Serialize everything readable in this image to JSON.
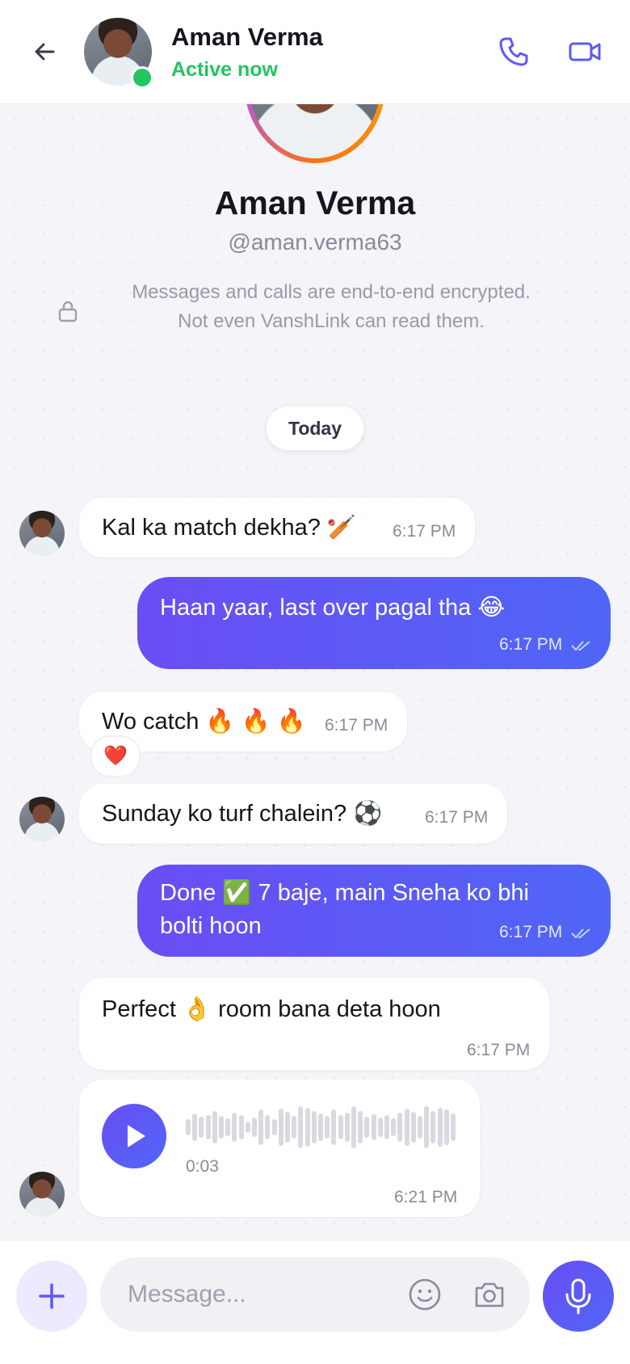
{
  "colors": {
    "accent": "#5b5bf5",
    "online": "#22c55e",
    "outgoing_start": "#6a4df4",
    "outgoing_end": "#4f66f6"
  },
  "header": {
    "name": "Aman Verma",
    "status": "Active now",
    "icons": [
      "back-arrow-icon",
      "phone-icon",
      "video-camera-icon"
    ]
  },
  "profile": {
    "name": "Aman Verma",
    "handle": "@aman.verma63",
    "encryption_line1": "Messages and calls are end-to-end encrypted.",
    "encryption_line2": "Not even VanshLink can read them."
  },
  "date_divider": "Today",
  "messages": [
    {
      "direction": "in",
      "text": "Kal ka match dekha? 🏏",
      "time": "6:17 PM"
    },
    {
      "direction": "out",
      "text": "Haan yaar, last over pagal tha 😂",
      "time": "6:17 PM"
    },
    {
      "direction": "in",
      "text": "Wo catch 🔥 🔥 🔥",
      "time": "6:17 PM",
      "reaction": "❤️"
    },
    {
      "direction": "in",
      "text": "Sunday ko turf chalein? ⚽",
      "time": "6:17 PM"
    },
    {
      "direction": "out",
      "text_line1": "Done ✅  7 baje, main Sneha ko bhi",
      "text_line2": "bolti hoon",
      "time": "6:17 PM"
    },
    {
      "direction": "in",
      "text": "Perfect 👌  room bana deta hoon",
      "time": "6:17 PM"
    },
    {
      "direction": "in",
      "type": "voice",
      "duration": "0:03",
      "time": "6:21 PM"
    }
  ],
  "composer": {
    "placeholder": "Message...",
    "icons": [
      "plus-icon",
      "emoji-icon",
      "camera-icon",
      "microphone-icon"
    ]
  }
}
